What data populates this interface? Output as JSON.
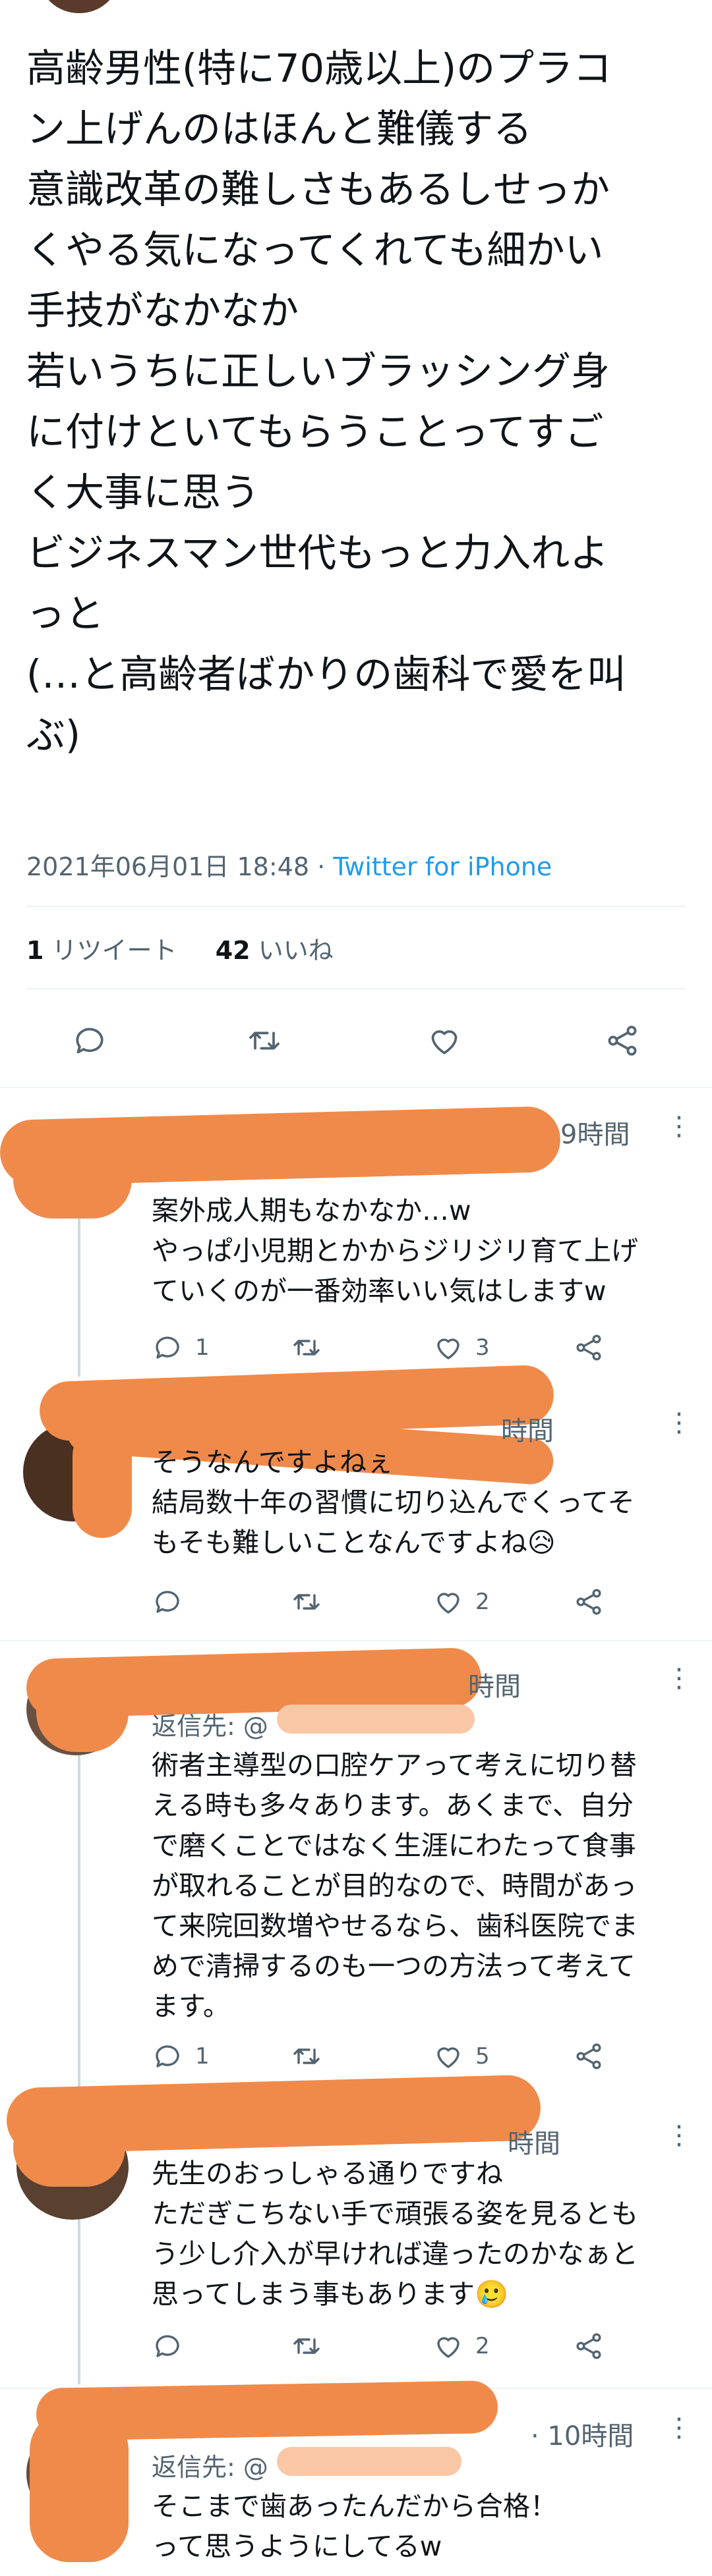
{
  "tweet": {
    "lines": [
      "高齢男性(特に70歳以上)のプラコ",
      "ン上げんのはほんと難儀する",
      "意識改革の難しさもあるしせっか",
      "くやる気になってくれても細かい",
      "手技がなかなか",
      "若いうちに正しいブラッシング身",
      "に付けといてもらうことってすご",
      "く大事に思う",
      "ビジネスマン世代もっと力入れよ",
      "っと",
      "(…と高齢者ばかりの歯科で愛を叫",
      "ぶ)"
    ],
    "date": "2021年06月01日 18:48",
    "separator": " · ",
    "source": "Twitter for iPhone",
    "retweets": "1",
    "retweets_label": " リツイート",
    "likes": "42",
    "likes_label": " いいね"
  },
  "colors": {
    "accent": "#1d9bf0",
    "scribble": "#f08a4b",
    "secondary_text": "#536471",
    "divider": "#eff3f4"
  },
  "icons": {
    "reply": "speech-bubble",
    "retweet": "retweet-arrows",
    "like": "heart",
    "share": "share-nodes",
    "more": "vertical-ellipsis"
  },
  "replies": [
    {
      "time": "9時間",
      "lines": [
        "案外成人期もなかなか…w",
        "やっぱ小児期とかからジリジリ育て上げ",
        "ていくのが一番効率いい気はしますw"
      ],
      "reply_count": "1",
      "like_count": "3"
    },
    {
      "time": "時間",
      "lines": [
        "そうなんですよねぇ",
        "結局数十年の習慣に切り込んでくってそ",
        "もそも難しいことなんですよね😥"
      ],
      "reply_count": "",
      "like_count": "2"
    },
    {
      "time": "時間",
      "reply_to": "返信先: @",
      "lines": [
        "術者主導型の口腔ケアって考えに切り替",
        "える時も多々あります。あくまで、自分",
        "で磨くことではなく生涯にわたって食事",
        "が取れることが目的なので、時間があっ",
        "て来院回数増やせるなら、歯科医院でま",
        "めで清掃するのも一つの方法って考えて",
        "ます。"
      ],
      "reply_count": "1",
      "like_count": "5"
    },
    {
      "time": "時間",
      "lines": [
        "先生のおっしゃる通りですね",
        "ただぎこちない手で頑張る姿を見るとも",
        "う少し介入が早ければ違ったのかなぁと",
        "思ってしまう事もあります🥲"
      ],
      "reply_count": "",
      "like_count": "2"
    },
    {
      "time": "· 10時間",
      "reply_to": "返信先: @",
      "lines": [
        "そこまで歯あったんだから合格！",
        "って思うようにしてるw"
      ]
    }
  ]
}
